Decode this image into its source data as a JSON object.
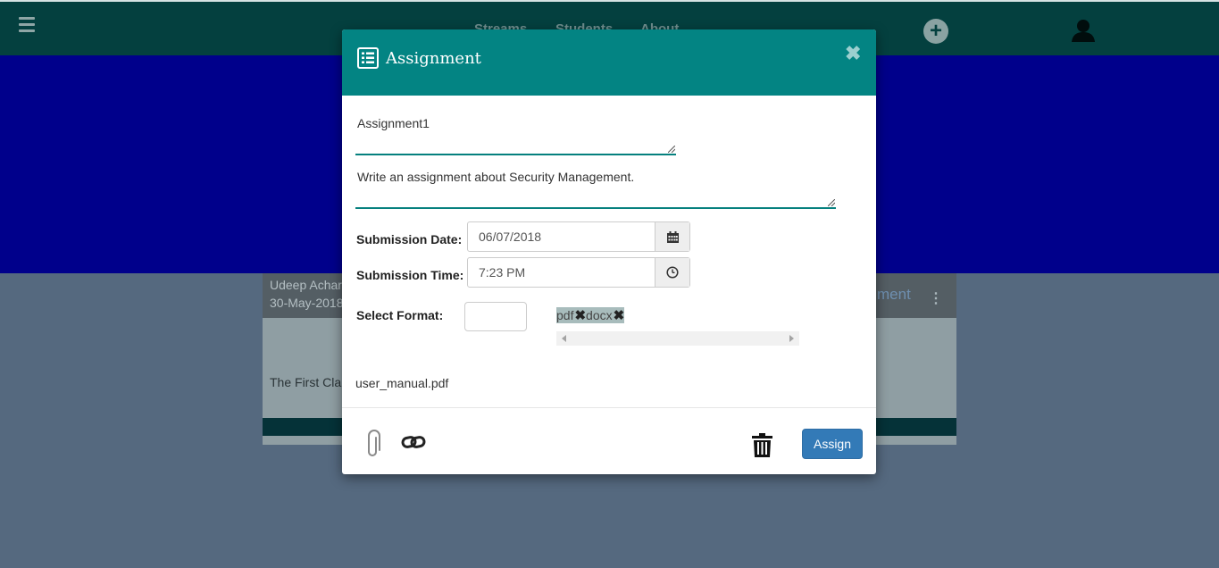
{
  "background": {
    "nav_items": [
      "Streams",
      "Students",
      "About"
    ],
    "card": {
      "author": "Udeep Achar",
      "date": "30-May-2018",
      "title_fragment": "ment",
      "body_fragment": "The First Cla"
    }
  },
  "modal": {
    "title": "Assignment",
    "assignment_name": "Assignment1",
    "description": "Write an assignment about Security Management.",
    "submission_date_label": "Submission Date:",
    "submission_date": "06/07/2018",
    "submission_time_label": "Submission Time:",
    "submission_time": "7:23 PM",
    "select_format_label": "Select Format:",
    "formats": [
      {
        "label": "pdf",
        "remove": "✖"
      },
      {
        "label": "docx",
        "remove": "✖"
      }
    ],
    "attached_file": "user_manual.pdf",
    "assign_label": "Assign",
    "close_glyph": "✖"
  },
  "colors": {
    "topbar": "#04403f",
    "banner": "#00008b",
    "modal_header": "#038483",
    "underline": "#05807e",
    "assign_button": "#337ab7"
  },
  "icons": [
    "hamburger-icon",
    "plus-circle-icon",
    "user-icon",
    "list-icon",
    "close-icon",
    "calendar-icon",
    "clock-icon",
    "paperclip-icon",
    "link-icon",
    "trash-icon"
  ]
}
